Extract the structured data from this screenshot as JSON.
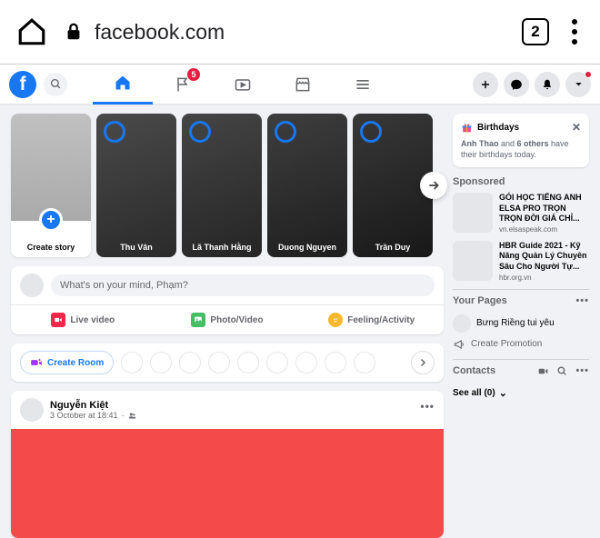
{
  "browser": {
    "url": "facebook.com",
    "tab_count": "2"
  },
  "nav": {
    "flag_badge": "5"
  },
  "stories": {
    "create_label": "Create story",
    "items": [
      {
        "name": "Thu Vân"
      },
      {
        "name": "Lã Thanh Hằng"
      },
      {
        "name": "Duong Nguyen"
      },
      {
        "name": "Trần Duy"
      }
    ]
  },
  "composer": {
    "placeholder": "What's on your mind, Phạm?",
    "live": "Live video",
    "photo": "Photo/Video",
    "feeling": "Feeling/Activity"
  },
  "rooms": {
    "create": "Create Room"
  },
  "post": {
    "author": "Nguyễn Kiệt",
    "time": "3 October at 18:41"
  },
  "birthdays": {
    "title": "Birthdays",
    "text_pre": "Anh Thao",
    "text_mid": " and ",
    "text_bold2": "6 others",
    "text_post": " have their birthdays today."
  },
  "sponsored": {
    "title": "Sponsored",
    "items": [
      {
        "title": "GÓI HỌC TIẾNG ANH ELSA PRO TRỌN TRỌN ĐỜI GIÁ CHỈ...",
        "domain": "vn.elsaspeak.com"
      },
      {
        "title": "HBR Guide 2021 - Kỹ Năng Quản Lý Chuyên Sâu Cho Người Tự...",
        "domain": "hbr.org.vn"
      }
    ]
  },
  "pages": {
    "title": "Your Pages",
    "page_name": "Bưng Riềng tui yêu",
    "promo": "Create Promotion"
  },
  "contacts": {
    "title": "Contacts",
    "see_all": "See all (0)"
  }
}
